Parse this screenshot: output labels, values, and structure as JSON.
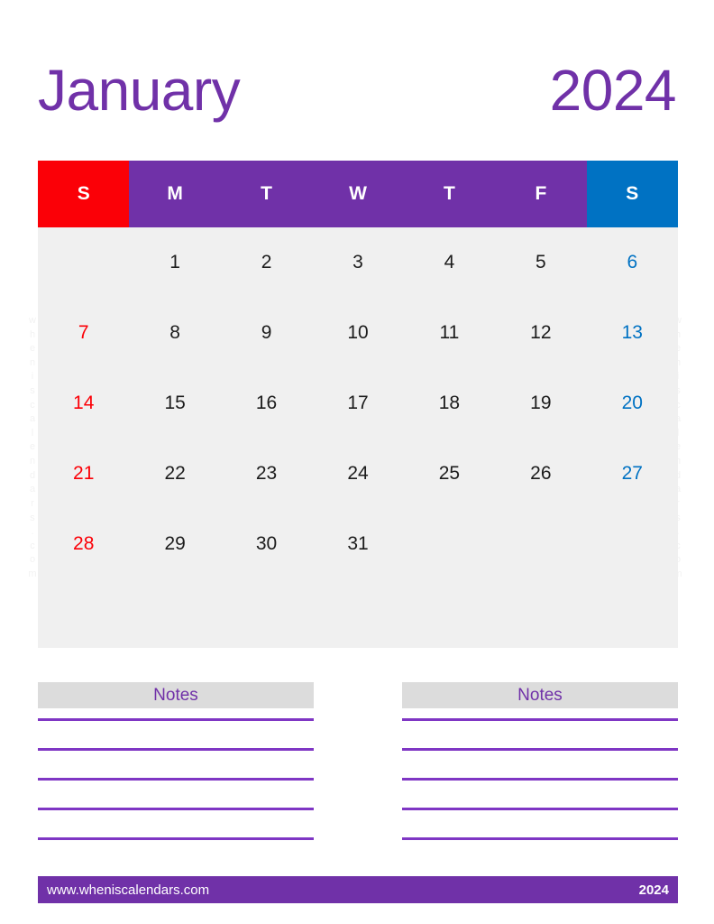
{
  "header": {
    "month": "January",
    "year": "2024"
  },
  "watermark": {
    "text": "wheniscalendars.com"
  },
  "calendar": {
    "weekday_headers": [
      {
        "label": "S",
        "kind": "sun"
      },
      {
        "label": "M",
        "kind": "weekday"
      },
      {
        "label": "T",
        "kind": "weekday"
      },
      {
        "label": "W",
        "kind": "weekday"
      },
      {
        "label": "T",
        "kind": "weekday"
      },
      {
        "label": "F",
        "kind": "weekday"
      },
      {
        "label": "S",
        "kind": "sat"
      }
    ],
    "weeks": [
      [
        {
          "day": "",
          "kind": "empty"
        },
        {
          "day": "1",
          "kind": "weekday"
        },
        {
          "day": "2",
          "kind": "weekday"
        },
        {
          "day": "3",
          "kind": "weekday"
        },
        {
          "day": "4",
          "kind": "weekday"
        },
        {
          "day": "5",
          "kind": "weekday"
        },
        {
          "day": "6",
          "kind": "sat"
        }
      ],
      [
        {
          "day": "7",
          "kind": "sun"
        },
        {
          "day": "8",
          "kind": "weekday"
        },
        {
          "day": "9",
          "kind": "weekday"
        },
        {
          "day": "10",
          "kind": "weekday"
        },
        {
          "day": "11",
          "kind": "weekday"
        },
        {
          "day": "12",
          "kind": "weekday"
        },
        {
          "day": "13",
          "kind": "sat"
        }
      ],
      [
        {
          "day": "14",
          "kind": "sun"
        },
        {
          "day": "15",
          "kind": "weekday"
        },
        {
          "day": "16",
          "kind": "weekday"
        },
        {
          "day": "17",
          "kind": "weekday"
        },
        {
          "day": "18",
          "kind": "weekday"
        },
        {
          "day": "19",
          "kind": "weekday"
        },
        {
          "day": "20",
          "kind": "sat"
        }
      ],
      [
        {
          "day": "21",
          "kind": "sun"
        },
        {
          "day": "22",
          "kind": "weekday"
        },
        {
          "day": "23",
          "kind": "weekday"
        },
        {
          "day": "24",
          "kind": "weekday"
        },
        {
          "day": "25",
          "kind": "weekday"
        },
        {
          "day": "26",
          "kind": "weekday"
        },
        {
          "day": "27",
          "kind": "sat"
        }
      ],
      [
        {
          "day": "28",
          "kind": "sun"
        },
        {
          "day": "29",
          "kind": "weekday"
        },
        {
          "day": "30",
          "kind": "weekday"
        },
        {
          "day": "31",
          "kind": "weekday"
        },
        {
          "day": "",
          "kind": "empty"
        },
        {
          "day": "",
          "kind": "empty"
        },
        {
          "day": "",
          "kind": "empty"
        }
      ]
    ]
  },
  "notes": {
    "left_title": "Notes",
    "right_title": "Notes",
    "line_count": 5
  },
  "footer": {
    "url": "www.wheniscalendars.com",
    "year": "2024"
  },
  "colors": {
    "purple": "#7031a8",
    "line_purple": "#7f36c4",
    "sunday_red": "#fb0007",
    "saturday_blue": "#0072c3",
    "grid_bg": "#f0f0f0",
    "notes_bg": "#dcdcdc"
  }
}
